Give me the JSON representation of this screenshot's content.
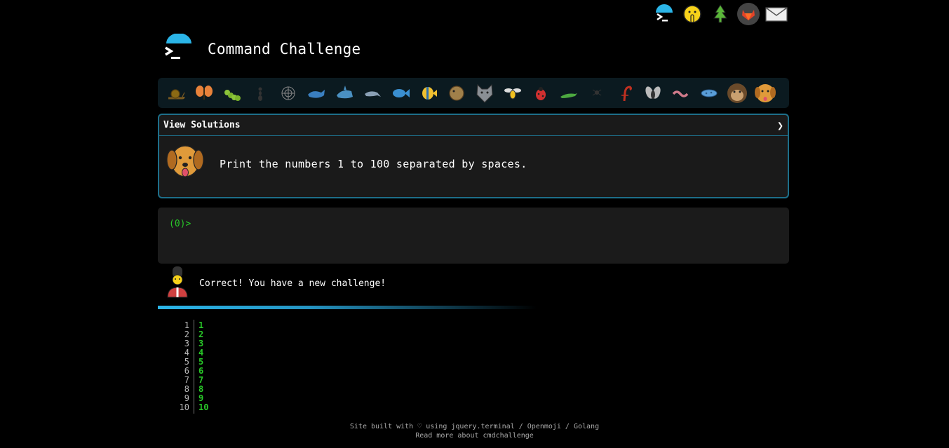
{
  "header": {
    "title": "Command Challenge"
  },
  "top_icons": [
    "terminal-icon",
    "shushing-face-icon",
    "tree-icon",
    "gitlab-fox-icon",
    "mail-icon"
  ],
  "emoji_bar": [
    "snail-icon",
    "butterfly-icon",
    "caterpillar-icon",
    "ant-icon",
    "spider-web-icon",
    "whale-icon",
    "shark-icon",
    "dolphin-icon",
    "fish-icon",
    "tropical-fish-icon",
    "pufferfish-icon",
    "wolf-icon",
    "bee-icon",
    "ladybug-icon",
    "lizard-icon",
    "spider-icon",
    "scorpion-icon",
    "fly-icon",
    "worm-icon",
    "microbe-icon",
    "monkey-icon",
    "dog-icon"
  ],
  "panel": {
    "toggle_label": "View Solutions",
    "challenge_text": "Print the numbers 1 to 100 separated by spaces."
  },
  "terminal": {
    "prompt": "(0)>"
  },
  "status": {
    "message": "Correct! You have a new challenge!"
  },
  "output": {
    "line_numbers": [
      "1",
      "2",
      "3",
      "4",
      "5",
      "6",
      "7",
      "8",
      "9",
      "10"
    ],
    "values": [
      "1",
      "2",
      "3",
      "4",
      "5",
      "6",
      "7",
      "8",
      "9",
      "10"
    ]
  },
  "footer": {
    "line1": "Site built with ♡ using jquery.terminal / Openmoji / Golang",
    "line2": "Read more about cmdchallenge"
  },
  "colors": {
    "accent": "#2bb5e8",
    "prompt": "#28c828",
    "panel_border": "#1d6f8a"
  }
}
